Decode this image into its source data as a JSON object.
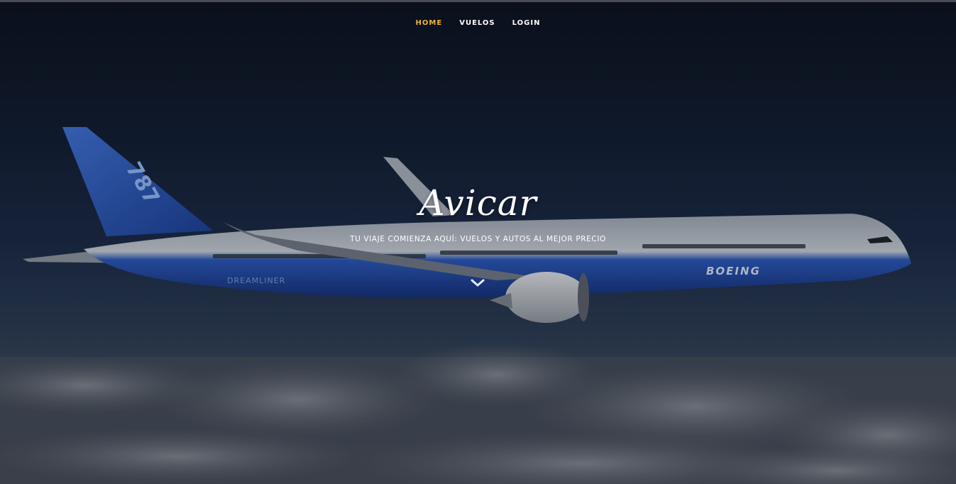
{
  "nav": {
    "items": [
      {
        "label": "HOME",
        "active": true
      },
      {
        "label": "VUELOS",
        "active": false
      },
      {
        "label": "LOGIN",
        "active": false
      }
    ]
  },
  "hero": {
    "title": "Avicar",
    "tagline": "TU VIAJE COMIENZA AQUÍ: VUELOS Y AUTOS AL MEJOR PRECIO",
    "scroll_icon": "chevron-down-icon",
    "background": {
      "tail_text": "787",
      "fuselage_logo": "BOEING",
      "engine_text": "DREAMLINER"
    }
  },
  "colors": {
    "nav_active": "#f0b43a",
    "nav_text": "#ffffff",
    "sky_top": "#0b111d",
    "plane_blue": "#1f4aa8"
  }
}
